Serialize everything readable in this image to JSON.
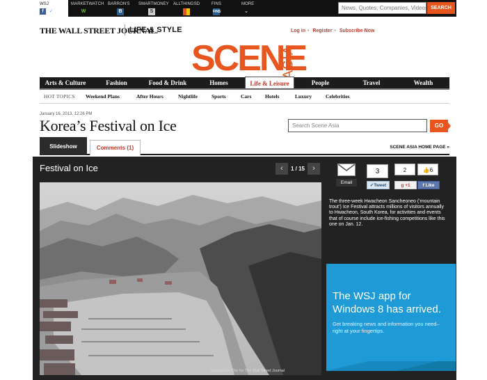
{
  "topbar": {
    "sites": [
      {
        "label": "WSJ"
      },
      {
        "label": "MARKETWATCH"
      },
      {
        "label": "BARRON'S"
      },
      {
        "label": "SMARTMONEY"
      },
      {
        "label": "ALLTHINGSD"
      },
      {
        "label": "FINS"
      },
      {
        "label": "MORE"
      }
    ],
    "search_placeholder": "News, Quotes, Companies, Videos",
    "search_button": "SEARCH"
  },
  "header": {
    "publication": "THE WALL STREET JOURNAL.",
    "section": "LIFE & STYLE",
    "login": "Log in",
    "register": "Register",
    "subscribe": "Subscribe Now",
    "logo_main": "SCENE",
    "logo_sub": "ASIA"
  },
  "nav": {
    "items": [
      "Arts & Culture",
      "Fashion",
      "Food & Drink",
      "Homes",
      "Life & Leisure",
      "People",
      "Travel",
      "Wealth"
    ],
    "active": "Life & Leisure"
  },
  "subnav": {
    "label": "HOT TOPICS",
    "items": [
      "Weekend Plans",
      "After Hours",
      "Nightlife",
      "Sports",
      "Cars",
      "Hotels",
      "Luxury",
      "Celebrities"
    ]
  },
  "article": {
    "timestamp": "January 16, 2013, 12:26 PM",
    "headline": "Korea’s Festival on Ice",
    "search_placeholder": "Search Scene Asia",
    "go_button": "GO",
    "tabs": {
      "slideshow": "Slideshow",
      "comments": "Comments (1)"
    },
    "home_link": "SCENE ASIA HOME PAGE »"
  },
  "slideshow": {
    "title": "Festival on Ice",
    "counter": "1 / 15",
    "credit": "SeongJoon Cho for The Wall Street Journal",
    "caption": "The three-week Hwacheon Sancheoneo (‘mountain trout’) Ice Festival attracts millions of visitors annually to Hwacheon, South Korea, for activities and events that of course include ice-fishing competitions like this one on Jan. 12."
  },
  "share": {
    "email_label": "Email",
    "tweet_count": "3",
    "tweet_label": "Tweet",
    "gplus_count": "2",
    "gplus_label": "+1",
    "like_count": "6",
    "like_label": "Like"
  },
  "ad": {
    "title": "The WSJ app for Windows 8 has arrived.",
    "body": "Get breaking news and information you need– right at your fingertips."
  },
  "colors": {
    "brand_orange": "#e8561f",
    "link_red": "#c0392b",
    "nav_dark": "#1c1c1c",
    "ad_blue": "#1e9ad6"
  }
}
